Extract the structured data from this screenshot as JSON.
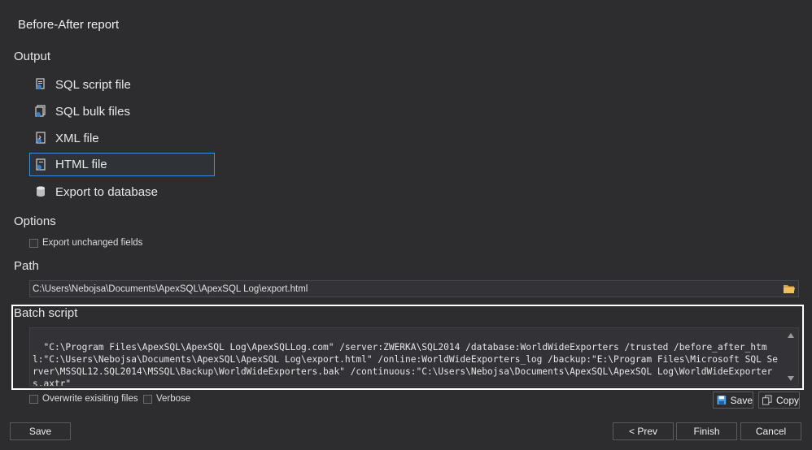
{
  "header": {
    "title": "Before-After report"
  },
  "output": {
    "heading": "Output",
    "items": [
      {
        "label": "SQL script file",
        "icon": "sql-script-icon",
        "selected": false
      },
      {
        "label": "SQL bulk files",
        "icon": "sql-bulk-icon",
        "selected": false
      },
      {
        "label": "XML file",
        "icon": "xml-file-icon",
        "selected": false
      },
      {
        "label": "HTML file",
        "icon": "html-file-icon",
        "selected": true
      },
      {
        "label": "Export to database",
        "icon": "database-icon",
        "selected": false
      }
    ]
  },
  "options": {
    "heading": "Options",
    "export_unchanged": {
      "label": "Export unchanged fields",
      "checked": false
    }
  },
  "path": {
    "heading": "Path",
    "value": "C:\\Users\\Nebojsa\\Documents\\ApexSQL\\ApexSQL Log\\export.html"
  },
  "batch": {
    "heading": "Batch script",
    "text": "\"C:\\Program Files\\ApexSQL\\ApexSQL Log\\ApexSQLLog.com\" /server:ZWERKA\\SQL2014 /database:WorldWideExporters /trusted /before_after_html:\"C:\\Users\\Nebojsa\\Documents\\ApexSQL\\ApexSQL Log\\export.html\" /online:WorldWideExporters_log /backup:\"E:\\Program Files\\Microsoft SQL Server\\MSSQL12.SQL2014\\MSSQL\\Backup\\WorldWideExporters.bak\" /continuous:\"C:\\Users\\Nebojsa\\Documents\\ApexSQL\\ApexSQL Log\\WorldWideExporters.axtr\"",
    "overwrite": {
      "label": "Overwrite exisiting files",
      "checked": false
    },
    "verbose": {
      "label": "Verbose",
      "checked": false
    },
    "save_label": "Save",
    "copy_label": "Copy"
  },
  "footer": {
    "save_label": "Save",
    "prev_label": "< Prev",
    "finish_label": "Finish",
    "cancel_label": "Cancel"
  },
  "colors": {
    "background": "#2d2d30",
    "selection_border": "#3d8ee0",
    "highlight_frame": "#ffffff",
    "save_icon": "#4a9fe8"
  }
}
